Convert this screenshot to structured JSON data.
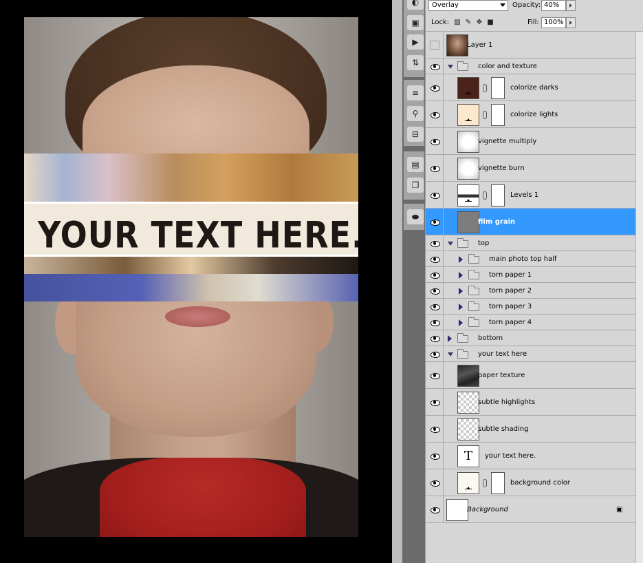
{
  "canvas": {
    "headline": "YOUR TEXT HERE."
  },
  "options": {
    "blend_mode": "Overlay",
    "opacity_label": "Opacity:",
    "opacity_value": "40%",
    "lock_label": "Lock:",
    "fill_label": "Fill:",
    "fill_value": "100%"
  },
  "layers": [
    {
      "name": "Layer 1",
      "type": "image",
      "visible": false
    },
    {
      "name": "color and texture",
      "type": "group",
      "expanded": true,
      "visible": true
    },
    {
      "name": "colorize darks",
      "type": "fill-mask",
      "thumb_color": "#4a2219",
      "visible": true
    },
    {
      "name": "colorize lights",
      "type": "fill-mask",
      "thumb_color": "#fce8cc",
      "visible": true
    },
    {
      "name": "vignette multiply",
      "type": "gradient",
      "visible": true
    },
    {
      "name": "vignette burn",
      "type": "gradient",
      "visible": true
    },
    {
      "name": "Levels 1",
      "type": "levels-mask",
      "visible": true
    },
    {
      "name": "film grain",
      "type": "gray",
      "thumb_color": "#7d7d7d",
      "visible": true,
      "selected": true
    },
    {
      "name": "top",
      "type": "group",
      "expanded": true,
      "visible": true
    },
    {
      "name": "main photo top half",
      "type": "subgroup",
      "visible": true
    },
    {
      "name": "torn paper 1",
      "type": "subgroup",
      "visible": true
    },
    {
      "name": "torn paper 2",
      "type": "subgroup",
      "visible": true
    },
    {
      "name": "torn paper 3",
      "type": "subgroup",
      "visible": true
    },
    {
      "name": "torn paper 4",
      "type": "subgroup",
      "visible": true
    },
    {
      "name": "bottom",
      "type": "group",
      "expanded": false,
      "visible": true
    },
    {
      "name": "your text here",
      "type": "group",
      "expanded": true,
      "visible": true
    },
    {
      "name": "paper texture",
      "type": "texture",
      "visible": true
    },
    {
      "name": "subtle highlights",
      "type": "transparent",
      "visible": true
    },
    {
      "name": "subtle shading",
      "type": "transparent",
      "visible": true
    },
    {
      "name": "your text here.",
      "type": "text",
      "thumb_glyph": "T",
      "visible": true
    },
    {
      "name": "background color",
      "type": "fill-mask",
      "thumb_color": "#fbf8f2",
      "visible": true
    },
    {
      "name": "Background",
      "type": "background",
      "locked": true,
      "visible": true
    }
  ],
  "icons": {
    "eye": "eye-icon",
    "lock": "padlock-icon"
  }
}
